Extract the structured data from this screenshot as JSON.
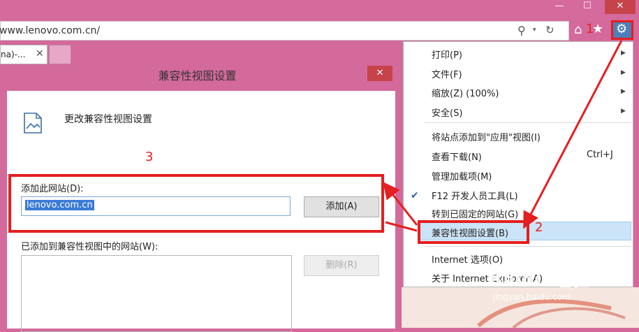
{
  "window": {
    "minimize": "—",
    "maximize": "☐",
    "close": "✕"
  },
  "address_bar": {
    "url": "www.lenovo.com.cn/",
    "search_dropdown": "▾"
  },
  "toolbar_icons": [
    "home-icon",
    "star-icon",
    "gear-icon"
  ],
  "tab": {
    "label": "na)-...",
    "close": "✕"
  },
  "dialog": {
    "title": "兼容性视图设置",
    "close": "✕",
    "heading": "更改兼容性视图设置",
    "add_site_label": "添加此网站(D):",
    "site_value": "lenovo.com.cn",
    "add_button": "添加(A)",
    "added_sites_label": "已添加到兼容性视图中的网站(W):",
    "remove_button": "删除(R)"
  },
  "menu": {
    "items": [
      "打印(P)",
      "文件(F)",
      "缩放(Z) (100%)",
      "安全(S)",
      "将站点添加到\"应用\"视图(I)",
      "查看下载(N)",
      "管理加载项(M)",
      "F12 开发人员工具(L)",
      "转到已固定的网站(G)",
      "兼容性视图设置(B)",
      "Internet 选项(O)",
      "关于 Internet Explorer(A)"
    ],
    "download_shortcut": "Ctrl+J",
    "checked_item": "F12 开发人员工具(L)",
    "highlighted_item": "兼容性视图设置(B)"
  },
  "annotations": {
    "step1": "1",
    "step2": "2",
    "step3": "3"
  },
  "watermark": {
    "main": "Baidu 经验",
    "sub": "jingyan.baidu.com"
  },
  "colors": {
    "window_frame": "#d4699b",
    "annotation_red": "#e41f1f",
    "selection_blue": "#3b7bd6"
  }
}
